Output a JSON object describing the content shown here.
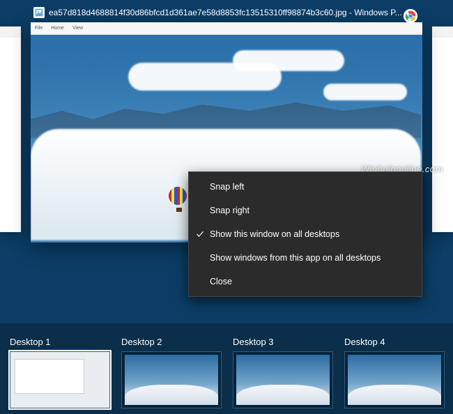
{
  "preview": {
    "title_prefix": "ea57d818d4688814f30d86bfcd1d361ae7e58d8853fc13515310ff98874b3c60.jpg - Windows P...",
    "menu_items": [
      "File",
      "Home",
      "View"
    ]
  },
  "watermark": "Winhelponline.com",
  "context_menu": {
    "items": [
      {
        "label": "Snap left",
        "checked": false
      },
      {
        "label": "Snap right",
        "checked": false
      },
      {
        "label": "Show this window on all desktops",
        "checked": true
      },
      {
        "label": "Show windows from this app on all desktops",
        "checked": false
      },
      {
        "label": "Close",
        "checked": false
      }
    ]
  },
  "desktops": [
    {
      "label": "Desktop 1",
      "active": true,
      "kind": "paper"
    },
    {
      "label": "Desktop 2",
      "active": false,
      "kind": "sky"
    },
    {
      "label": "Desktop 3",
      "active": false,
      "kind": "sky"
    },
    {
      "label": "Desktop 4",
      "active": false,
      "kind": "sky"
    }
  ]
}
